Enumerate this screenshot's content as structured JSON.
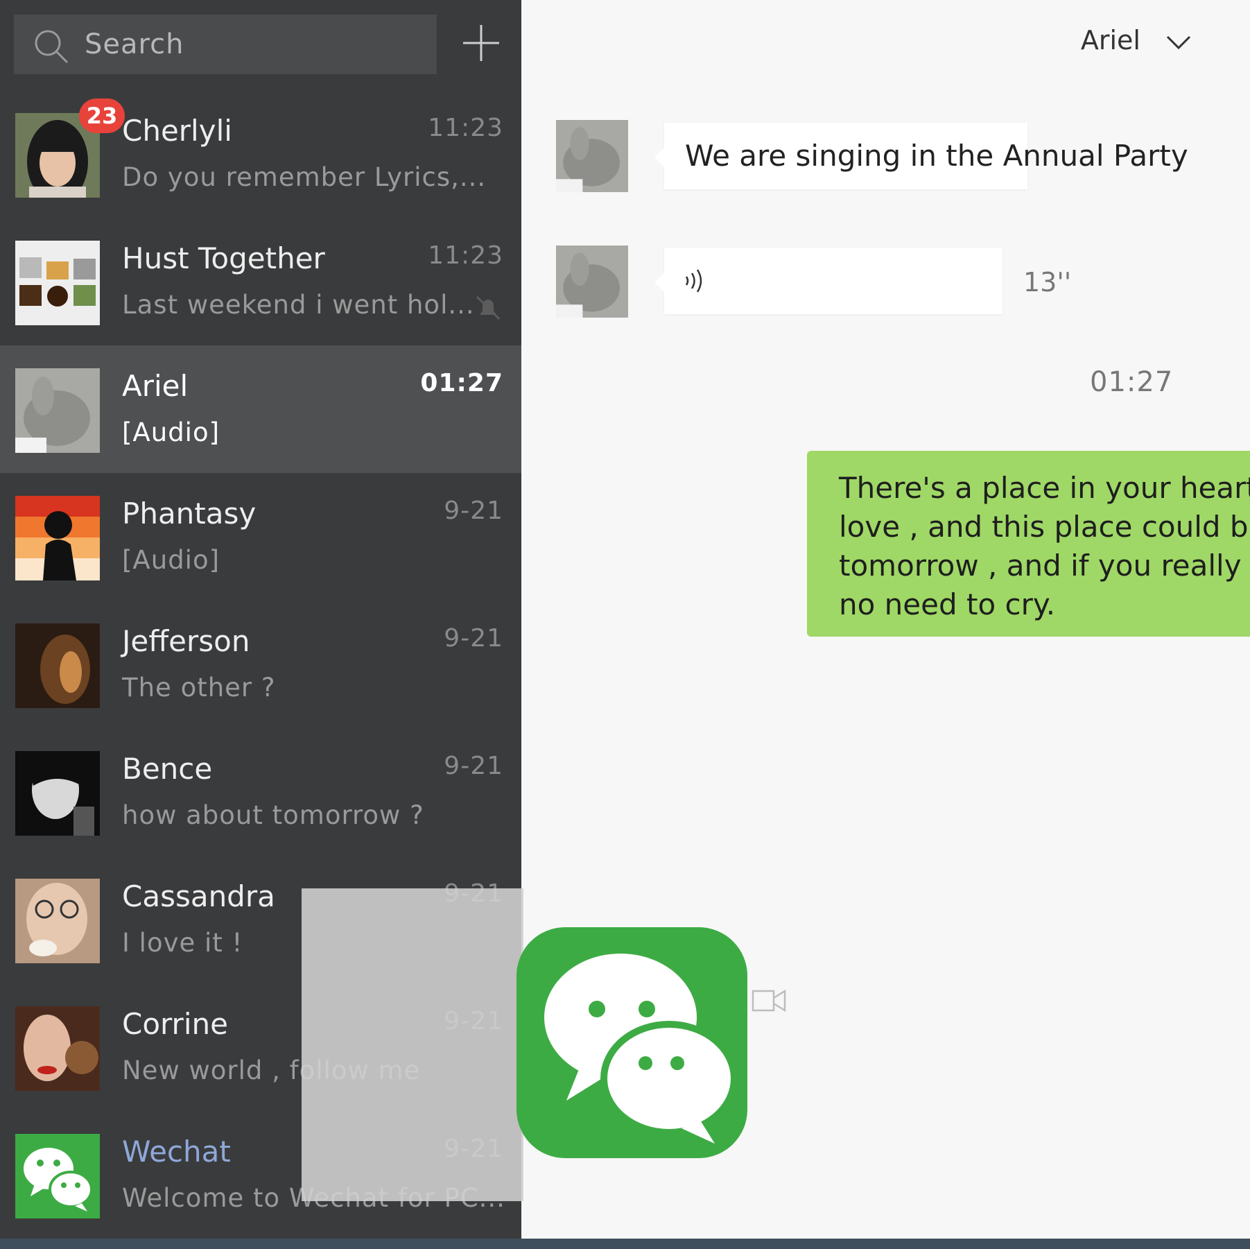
{
  "search": {
    "placeholder": "Search"
  },
  "chats": [
    {
      "name": "Cherlyli",
      "preview": "Do you remember Lyrics,...",
      "time": "11:23",
      "badge": "23"
    },
    {
      "name": "Hust Together",
      "preview": "Last weekend i went hol...",
      "time": "11:23",
      "muted": true
    },
    {
      "name": "Ariel",
      "preview": "[Audio]",
      "time": "01:27",
      "active": true
    },
    {
      "name": "Phantasy",
      "preview": "[Audio]",
      "time": "9-21"
    },
    {
      "name": "Jefferson",
      "preview": "The other ?",
      "time": "9-21"
    },
    {
      "name": "Bence",
      "preview": "how about tomorrow ?",
      "time": "9-21"
    },
    {
      "name": "Cassandra",
      "preview": "I love it  !",
      "time": "9-21"
    },
    {
      "name": "Corrine",
      "preview": "New  world ,  follow me",
      "time": "9-21"
    },
    {
      "name": "Wechat",
      "preview": "Welcome to Wechat for PC...",
      "time": "9-21"
    }
  ],
  "conversation": {
    "contact": "Ariel",
    "messages": [
      {
        "text": "We are singing in the Annual Party"
      },
      {
        "audio_duration": "13''"
      }
    ],
    "time_divider": "01:27",
    "outgoing": "There's a place in your heart , and i know that it is\nlove , and this place could be much brighter than\ntomorrow , and if you really try ,  you'll find there's\nno need to cry."
  },
  "colors": {
    "sidebar": "#3a3b3d",
    "active_row": "#4f5052",
    "badge": "#e8433a",
    "outgoing_bubble": "#9fd866",
    "wechat_green": "#3dab44"
  }
}
